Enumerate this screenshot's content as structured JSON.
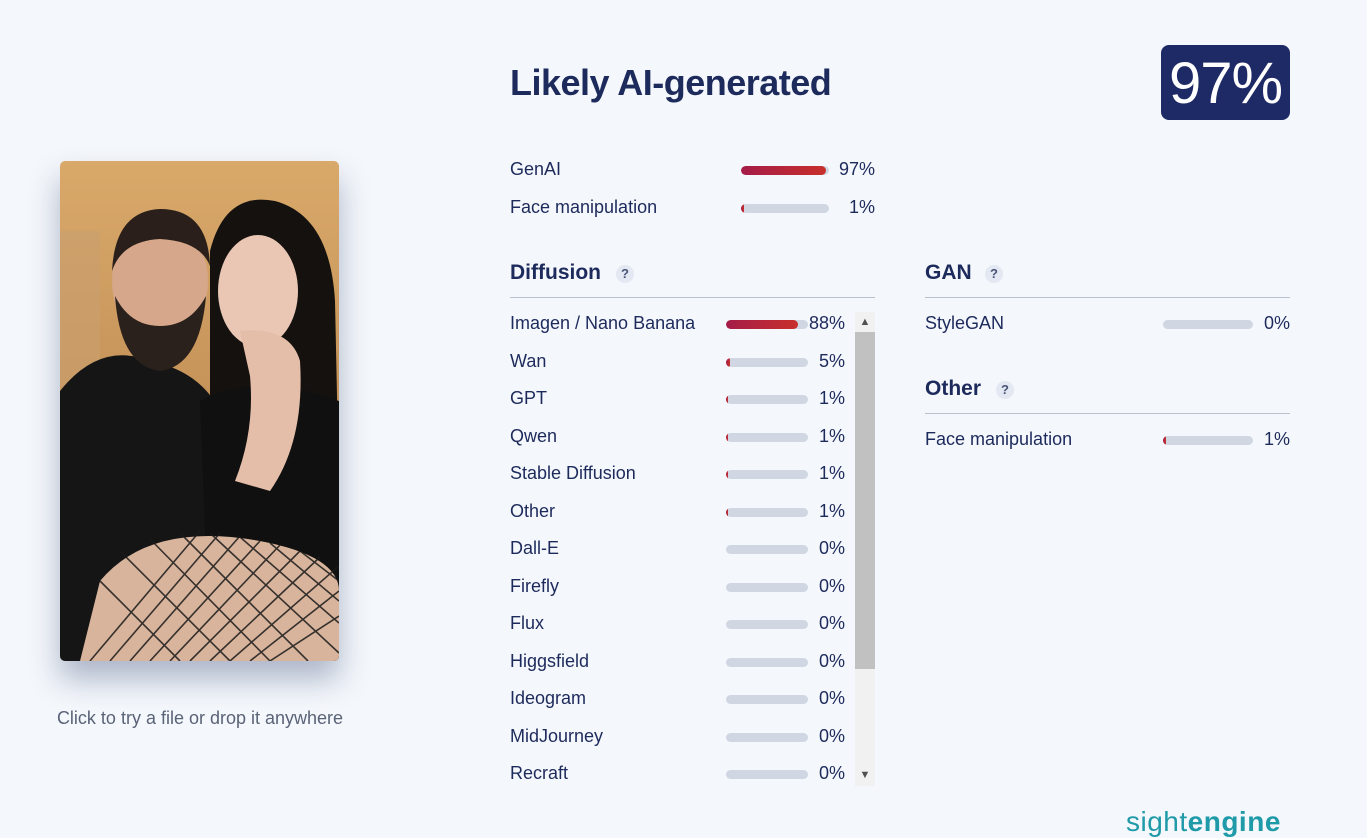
{
  "verdict": "Likely AI-generated",
  "score": "97%",
  "drop_hint": "Click to try a file or drop it anywhere",
  "summary": [
    {
      "label": "GenAI",
      "value": 97,
      "pct": "97%"
    },
    {
      "label": "Face manipulation",
      "value": 1,
      "pct": "1%"
    }
  ],
  "diffusion": {
    "title": "Diffusion",
    "help": "?",
    "items": [
      {
        "label": "Imagen / Nano Banana",
        "value": 88,
        "pct": "88%"
      },
      {
        "label": "Wan",
        "value": 5,
        "pct": "5%"
      },
      {
        "label": "GPT",
        "value": 1,
        "pct": "1%"
      },
      {
        "label": "Qwen",
        "value": 1,
        "pct": "1%"
      },
      {
        "label": "Stable Diffusion",
        "value": 1,
        "pct": "1%"
      },
      {
        "label": "Other",
        "value": 1,
        "pct": "1%"
      },
      {
        "label": "Dall-E",
        "value": 0,
        "pct": "0%"
      },
      {
        "label": "Firefly",
        "value": 0,
        "pct": "0%"
      },
      {
        "label": "Flux",
        "value": 0,
        "pct": "0%"
      },
      {
        "label": "Higgsfield",
        "value": 0,
        "pct": "0%"
      },
      {
        "label": "Ideogram",
        "value": 0,
        "pct": "0%"
      },
      {
        "label": "MidJourney",
        "value": 0,
        "pct": "0%"
      },
      {
        "label": "Recraft",
        "value": 0,
        "pct": "0%"
      }
    ]
  },
  "gan": {
    "title": "GAN",
    "help": "?",
    "items": [
      {
        "label": "StyleGAN",
        "value": 0,
        "pct": "0%"
      }
    ]
  },
  "other": {
    "title": "Other",
    "help": "?",
    "items": [
      {
        "label": "Face manipulation",
        "value": 1,
        "pct": "1%"
      }
    ]
  },
  "scrollbar": {
    "up_icon": "chevron-up-icon",
    "down_icon": "chevron-down-icon"
  },
  "brand": {
    "part1": "sight",
    "part2": "engine"
  },
  "colors": {
    "accent": "#1d2a66",
    "bar_fill_start": "#a51c48",
    "bar_fill_end": "#c8302c",
    "bar_track": "#d0d7e3",
    "brand": "#1e9aa8"
  }
}
